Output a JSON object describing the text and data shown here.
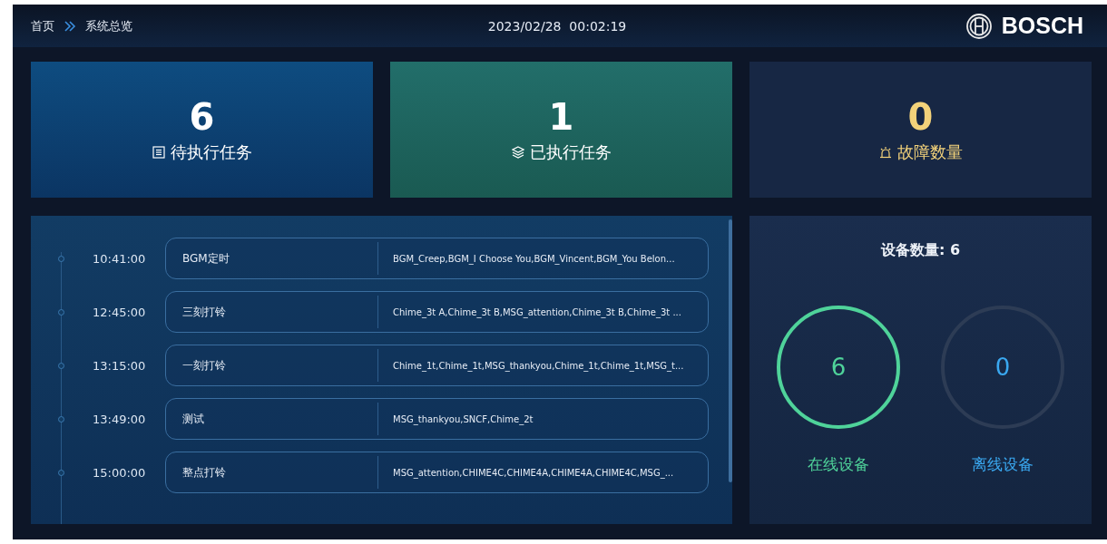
{
  "header": {
    "breadcrumb": [
      "首页",
      "系统总览"
    ],
    "datetime": "2023/02/28  00:02:19",
    "brand": "BOSCH"
  },
  "stats": [
    {
      "kind": "pending",
      "value": "6",
      "label": "待执行任务"
    },
    {
      "kind": "done",
      "value": "1",
      "label": "已执行任务"
    },
    {
      "kind": "fault",
      "value": "0",
      "label": "故障数量"
    }
  ],
  "schedule": [
    {
      "time": "10:41:00",
      "name": "BGM定时",
      "items": "BGM_Creep,BGM_I Choose You,BGM_Vincent,BGM_You Belon..."
    },
    {
      "time": "12:45:00",
      "name": "三刻打铃",
      "items": "Chime_3t A,Chime_3t B,MSG_attention,Chime_3t B,Chime_3t ..."
    },
    {
      "time": "13:15:00",
      "name": "一刻打铃",
      "items": "Chime_1t,Chime_1t,MSG_thankyou,Chime_1t,Chime_1t,MSG_t..."
    },
    {
      "time": "13:49:00",
      "name": "测试",
      "items": "MSG_thankyou,SNCF,Chime_2t"
    },
    {
      "time": "15:00:00",
      "name": "整点打铃",
      "items": "MSG_attention,CHIME4C,CHIME4A,CHIME4A,CHIME4C,MSG_..."
    }
  ],
  "devices": {
    "title": "设备数量: 6",
    "groups": [
      {
        "value": "6",
        "label": "在线设备",
        "color": "#4fd39a",
        "on": true
      },
      {
        "value": "0",
        "label": "离线设备",
        "color": "#3aa8f0",
        "on": false
      }
    ]
  }
}
